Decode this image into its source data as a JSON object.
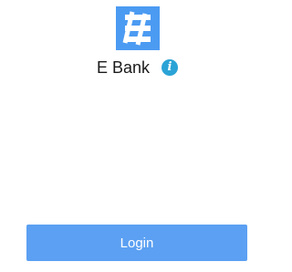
{
  "app": {
    "name": "E Bank",
    "logo_icon": "ebank-logo-icon",
    "logo_color": "#4C9BF2",
    "info_icon": "info-icon",
    "info_glyph": "i",
    "info_color": "#2BA3D6"
  },
  "login": {
    "label": "Login",
    "color": "#5BA0F2"
  }
}
